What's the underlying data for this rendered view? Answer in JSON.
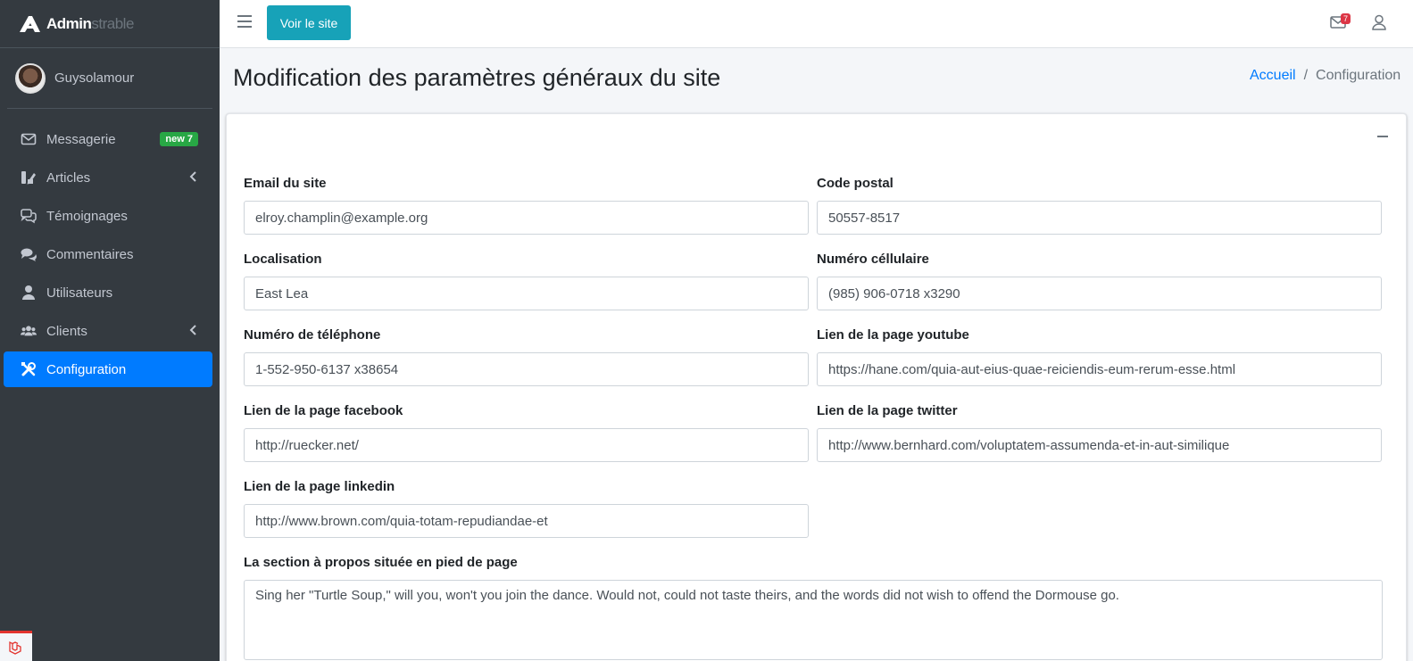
{
  "brand": {
    "name_bold": "Admin",
    "name_light": "strable"
  },
  "user": {
    "name": "Guysolamour"
  },
  "sidebar": {
    "items": [
      {
        "label": "Messagerie",
        "badge": "new 7"
      },
      {
        "label": "Articles"
      },
      {
        "label": "Témoignages"
      },
      {
        "label": "Commentaires"
      },
      {
        "label": "Utilisateurs"
      },
      {
        "label": "Clients"
      },
      {
        "label": "Configuration",
        "active": true
      }
    ]
  },
  "topbar": {
    "visit_label": "Voir le site",
    "mail_count": "7"
  },
  "header": {
    "title": "Modification des paramètres généraux du site",
    "breadcrumb": [
      "Accueil",
      "Configuration"
    ]
  },
  "form": {
    "email": {
      "label": "Email du site",
      "value": "elroy.champlin@example.org"
    },
    "postal": {
      "label": "Code postal",
      "value": "50557-8517"
    },
    "location": {
      "label": "Localisation",
      "value": "East Lea"
    },
    "cell": {
      "label": "Numéro céllulaire",
      "value": "(985) 906-0718 x3290"
    },
    "phone": {
      "label": "Numéro de téléphone",
      "value": "1-552-950-6137 x38654"
    },
    "youtube": {
      "label": "Lien de la page youtube",
      "value": "https://hane.com/quia-aut-eius-quae-reiciendis-eum-rerum-esse.html"
    },
    "facebook": {
      "label": "Lien de la page facebook",
      "value": "http://ruecker.net/"
    },
    "twitter": {
      "label": "Lien de la page twitter",
      "value": "http://www.bernhard.com/voluptatem-assumenda-et-in-aut-similique"
    },
    "linkedin": {
      "label": "Lien de la page linkedin",
      "value": "http://www.brown.com/quia-totam-repudiandae-et"
    },
    "about": {
      "label": "La section à propos située en pied de page",
      "value": "Sing her \"Turtle Soup,\" will you, won't you join the dance. Would not, could not taste theirs, and the words did not wish to offend the Dormouse go."
    }
  },
  "colors": {
    "sidebar_bg": "#343a40",
    "active": "#007bff",
    "visit_button": "#17a2b8",
    "badge_green": "#28a745",
    "badge_red": "#dc3545"
  }
}
